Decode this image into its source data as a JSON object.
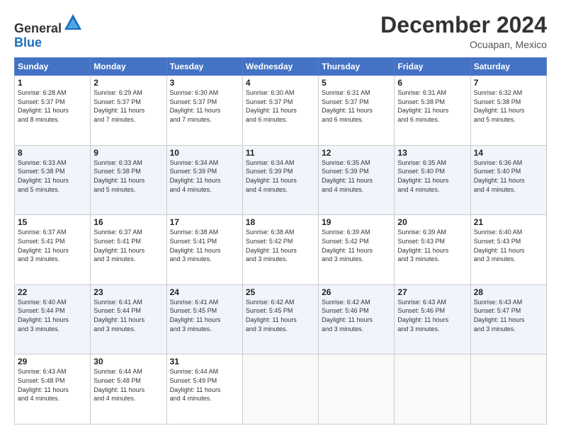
{
  "logo": {
    "general": "General",
    "blue": "Blue"
  },
  "header": {
    "month": "December 2024",
    "location": "Ocuapan, Mexico"
  },
  "weekdays": [
    "Sunday",
    "Monday",
    "Tuesday",
    "Wednesday",
    "Thursday",
    "Friday",
    "Saturday"
  ],
  "weeks": [
    [
      {
        "day": "1",
        "sunrise": "6:28 AM",
        "sunset": "5:37 PM",
        "daylight": "11 hours and 8 minutes."
      },
      {
        "day": "2",
        "sunrise": "6:29 AM",
        "sunset": "5:37 PM",
        "daylight": "11 hours and 7 minutes."
      },
      {
        "day": "3",
        "sunrise": "6:30 AM",
        "sunset": "5:37 PM",
        "daylight": "11 hours and 7 minutes."
      },
      {
        "day": "4",
        "sunrise": "6:30 AM",
        "sunset": "5:37 PM",
        "daylight": "11 hours and 6 minutes."
      },
      {
        "day": "5",
        "sunrise": "6:31 AM",
        "sunset": "5:37 PM",
        "daylight": "11 hours and 6 minutes."
      },
      {
        "day": "6",
        "sunrise": "6:31 AM",
        "sunset": "5:38 PM",
        "daylight": "11 hours and 6 minutes."
      },
      {
        "day": "7",
        "sunrise": "6:32 AM",
        "sunset": "5:38 PM",
        "daylight": "11 hours and 5 minutes."
      }
    ],
    [
      {
        "day": "8",
        "sunrise": "6:33 AM",
        "sunset": "5:38 PM",
        "daylight": "11 hours and 5 minutes."
      },
      {
        "day": "9",
        "sunrise": "6:33 AM",
        "sunset": "5:38 PM",
        "daylight": "11 hours and 5 minutes."
      },
      {
        "day": "10",
        "sunrise": "6:34 AM",
        "sunset": "5:39 PM",
        "daylight": "11 hours and 4 minutes."
      },
      {
        "day": "11",
        "sunrise": "6:34 AM",
        "sunset": "5:39 PM",
        "daylight": "11 hours and 4 minutes."
      },
      {
        "day": "12",
        "sunrise": "6:35 AM",
        "sunset": "5:39 PM",
        "daylight": "11 hours and 4 minutes."
      },
      {
        "day": "13",
        "sunrise": "6:35 AM",
        "sunset": "5:40 PM",
        "daylight": "11 hours and 4 minutes."
      },
      {
        "day": "14",
        "sunrise": "6:36 AM",
        "sunset": "5:40 PM",
        "daylight": "11 hours and 4 minutes."
      }
    ],
    [
      {
        "day": "15",
        "sunrise": "6:37 AM",
        "sunset": "5:41 PM",
        "daylight": "11 hours and 3 minutes."
      },
      {
        "day": "16",
        "sunrise": "6:37 AM",
        "sunset": "5:41 PM",
        "daylight": "11 hours and 3 minutes."
      },
      {
        "day": "17",
        "sunrise": "6:38 AM",
        "sunset": "5:41 PM",
        "daylight": "11 hours and 3 minutes."
      },
      {
        "day": "18",
        "sunrise": "6:38 AM",
        "sunset": "5:42 PM",
        "daylight": "11 hours and 3 minutes."
      },
      {
        "day": "19",
        "sunrise": "6:39 AM",
        "sunset": "5:42 PM",
        "daylight": "11 hours and 3 minutes."
      },
      {
        "day": "20",
        "sunrise": "6:39 AM",
        "sunset": "5:43 PM",
        "daylight": "11 hours and 3 minutes."
      },
      {
        "day": "21",
        "sunrise": "6:40 AM",
        "sunset": "5:43 PM",
        "daylight": "11 hours and 3 minutes."
      }
    ],
    [
      {
        "day": "22",
        "sunrise": "6:40 AM",
        "sunset": "5:44 PM",
        "daylight": "11 hours and 3 minutes."
      },
      {
        "day": "23",
        "sunrise": "6:41 AM",
        "sunset": "5:44 PM",
        "daylight": "11 hours and 3 minutes."
      },
      {
        "day": "24",
        "sunrise": "6:41 AM",
        "sunset": "5:45 PM",
        "daylight": "11 hours and 3 minutes."
      },
      {
        "day": "25",
        "sunrise": "6:42 AM",
        "sunset": "5:45 PM",
        "daylight": "11 hours and 3 minutes."
      },
      {
        "day": "26",
        "sunrise": "6:42 AM",
        "sunset": "5:46 PM",
        "daylight": "11 hours and 3 minutes."
      },
      {
        "day": "27",
        "sunrise": "6:43 AM",
        "sunset": "5:46 PM",
        "daylight": "11 hours and 3 minutes."
      },
      {
        "day": "28",
        "sunrise": "6:43 AM",
        "sunset": "5:47 PM",
        "daylight": "11 hours and 3 minutes."
      }
    ],
    [
      {
        "day": "29",
        "sunrise": "6:43 AM",
        "sunset": "5:48 PM",
        "daylight": "11 hours and 4 minutes."
      },
      {
        "day": "30",
        "sunrise": "6:44 AM",
        "sunset": "5:48 PM",
        "daylight": "11 hours and 4 minutes."
      },
      {
        "day": "31",
        "sunrise": "6:44 AM",
        "sunset": "5:49 PM",
        "daylight": "11 hours and 4 minutes."
      },
      null,
      null,
      null,
      null
    ]
  ],
  "labels": {
    "sunrise": "Sunrise:",
    "sunset": "Sunset:",
    "daylight": "Daylight:"
  }
}
